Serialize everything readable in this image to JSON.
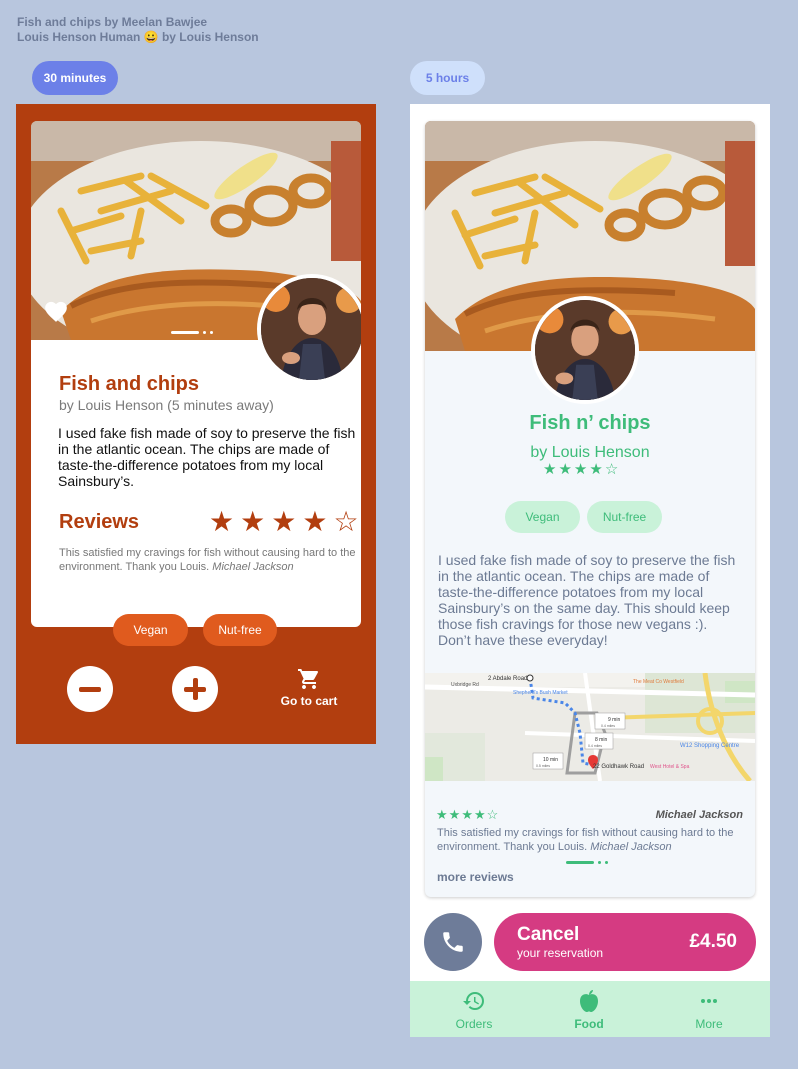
{
  "credits": {
    "line1": "Fish and chips by Meelan Bawjee",
    "line2": "Louis Henson Human 😀 by Louis Henson"
  },
  "labels": {
    "left_time": "30 minutes",
    "right_time": "5 hours"
  },
  "left_card": {
    "title": "Fish and chips",
    "byline": "by Louis Henson (5 minutes away)",
    "description": "I used fake fish made of soy to preserve the fish in the atlantic ocean. The chips are made of taste-the-difference potatoes from my local Sainsbury’s.",
    "reviews_heading": "Reviews",
    "rating": 4,
    "rating_max": 5,
    "review_text": "This satisfied my cravings for fish without causing hard to the environment. Thank you Louis.",
    "review_author": "Michael Jackson",
    "tags": [
      "Vegan",
      "Nut-free"
    ],
    "cart_label": "Go to cart"
  },
  "right_card": {
    "title": "Fish n’ chips",
    "byline": "by Louis Henson",
    "rating": 4,
    "rating_max": 5,
    "tags": [
      "Vegan",
      "Nut-free"
    ],
    "description": "I used fake fish made of soy to preserve the fish in the atlantic ocean. The chips are made of taste-the-difference potatoes from my local Sainsbury’s on the same day. This should keep those fish cravings for those new vegans :). Don’t have these everyday!",
    "map": {
      "road1": "2 Abdale Road",
      "road2": "22 Goldhawk Road",
      "place1": "The Meat Co Westfield",
      "place2": "W12 Shopping Centre",
      "place3": "West Hotel & Spa",
      "place4": "Shepherd's Bush Market",
      "street1": "Uxbridge Rd",
      "walk1": "9 min",
      "walk1_dist": "0.4 miles",
      "walk2": "8 min",
      "walk2_dist": "0.4 miles",
      "walk3": "10 min",
      "walk3_dist": "0.5 miles"
    },
    "review_rating": 4,
    "reviewer": "Michael Jackson",
    "review_text": "This satisfied my cravings for fish without causing hard to the environment. Thank you Louis.",
    "review_author": "Michael Jackson",
    "more_reviews": "more reviews"
  },
  "actions": {
    "cancel_title": "Cancel",
    "cancel_sub": "your reservation",
    "price": "£4.50"
  },
  "nav": {
    "orders": "Orders",
    "food": "Food",
    "more": "More"
  },
  "colors": {
    "background": "#b8c6de",
    "left_accent": "#b23e0f",
    "tag_left": "#e05b1e",
    "green": "#3ebc7a",
    "green_light": "#c9f2d9",
    "cancel": "#d53b82",
    "slate": "#6e7c99",
    "pill_blue": "#6c80e8"
  },
  "icons": [
    "heart-icon",
    "minus-icon",
    "plus-icon",
    "cart-icon",
    "star-icon",
    "phone-icon",
    "history-icon",
    "apple-icon",
    "more-dots-icon",
    "map-pin-icon"
  ]
}
